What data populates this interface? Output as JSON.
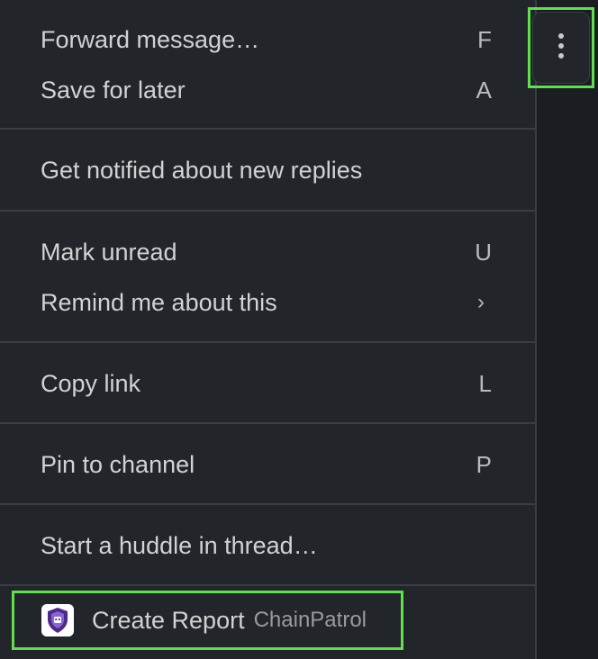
{
  "menu": {
    "sections": [
      {
        "items": [
          {
            "label": "Forward message…",
            "shortcut": "F"
          },
          {
            "label": "Save for later",
            "shortcut": "A"
          }
        ]
      },
      {
        "items": [
          {
            "label": "Get notified about new replies"
          }
        ]
      },
      {
        "items": [
          {
            "label": "Mark unread",
            "shortcut": "U"
          },
          {
            "label": "Remind me about this",
            "submenu_indicator": "›"
          }
        ]
      },
      {
        "items": [
          {
            "label": "Copy link",
            "shortcut": "L"
          }
        ]
      },
      {
        "items": [
          {
            "label": "Pin to channel",
            "shortcut": "P"
          }
        ]
      },
      {
        "items": [
          {
            "label": "Start a huddle in thread…"
          }
        ]
      }
    ],
    "app_action": {
      "label": "Create Report",
      "app_name": "ChainPatrol",
      "icon": "chainpatrol-shield-icon"
    }
  },
  "more_actions_button": {
    "icon": "more-vertical-icon"
  },
  "colors": {
    "menu_bg": "#222529",
    "divider": "#3a3d42",
    "text": "#d1d2d3",
    "highlight": "#5fe04c",
    "app_icon_purple": "#4b2a8c"
  }
}
